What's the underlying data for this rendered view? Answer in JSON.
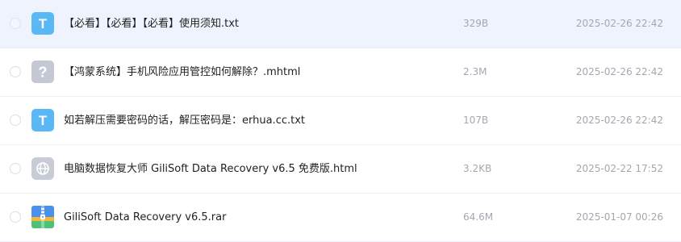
{
  "files": [
    {
      "name": "【必看】【必看】【必看】使用须知.txt",
      "size": "329B",
      "date": "2025-02-26 22:42",
      "icon": "text-file-icon",
      "selected": true
    },
    {
      "name": "【鸿蒙系统】手机风险应用管控如何解除？.mhtml",
      "size": "2.3M",
      "date": "2025-02-26 22:42",
      "icon": "unknown-file-icon",
      "selected": false
    },
    {
      "name": "如若解压需要密码的话，解压密码是：erhua.cc.txt",
      "size": "107B",
      "date": "2025-02-26 22:42",
      "icon": "text-file-icon",
      "selected": false
    },
    {
      "name": "电脑数据恢复大师 GiliSoft Data Recovery v6.5 免费版.html",
      "size": "3.2KB",
      "date": "2025-02-22 17:52",
      "icon": "web-file-icon",
      "selected": false
    },
    {
      "name": "GiliSoft Data Recovery v6.5.rar",
      "size": "64.6M",
      "date": "2025-01-07 00:26",
      "icon": "archive-file-icon",
      "selected": false
    }
  ],
  "icon_text": {
    "text_file_glyph": "T",
    "unknown_file_glyph": "?"
  },
  "colors": {
    "selected_row_bg": "#eef3fd",
    "text_icon_bg": "#5ab8f5",
    "unknown_icon_bg": "#c3c8d2",
    "web_icon_bg": "#c7ccd6",
    "row_divider": "#ebeef5",
    "meta_text": "#a3a8b0"
  }
}
